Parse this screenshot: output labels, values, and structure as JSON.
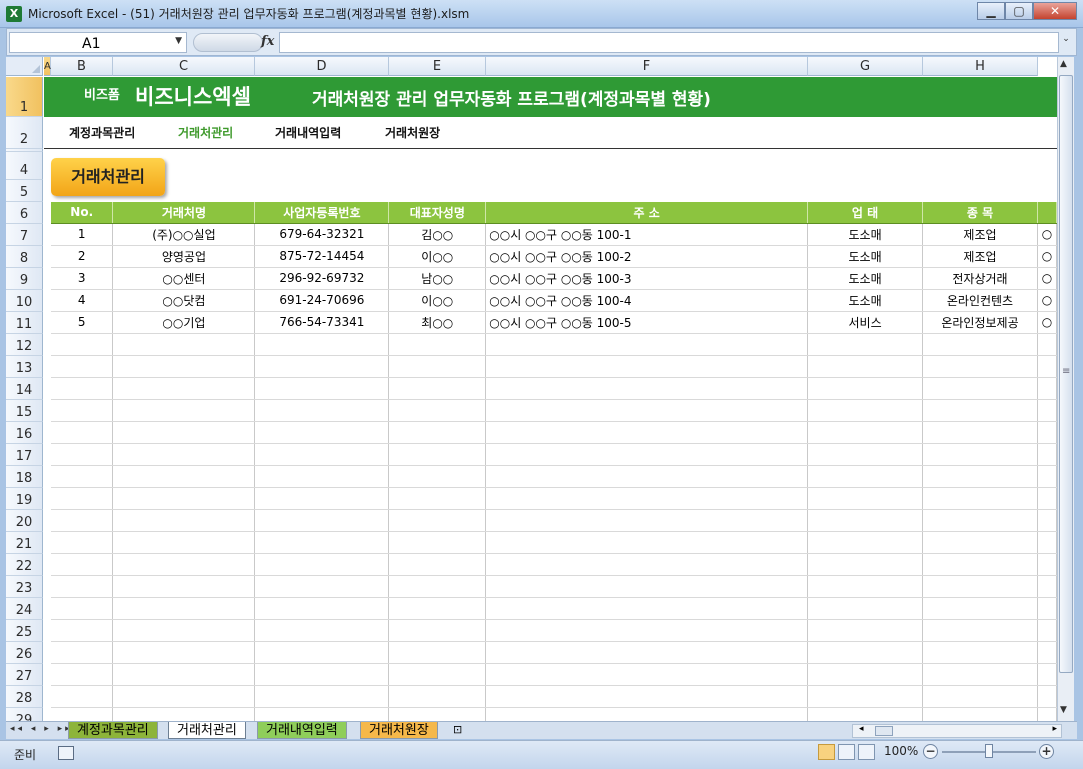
{
  "window": {
    "title": "Microsoft Excel - (51) 거래처원장 관리 업무자동화 프로그램(계정과목별 현황).xlsm",
    "app_icon": "X",
    "min_label": "▁",
    "max_label": "▢",
    "close_label": "✕"
  },
  "formula_bar": {
    "name_box": "A1",
    "fx_label": "fx",
    "formula": ""
  },
  "columns": [
    "A",
    "B",
    "C",
    "D",
    "E",
    "F",
    "G",
    "H"
  ],
  "rows": [
    "1",
    "2",
    "3",
    "4",
    "5",
    "6",
    "7",
    "8",
    "9",
    "10",
    "11",
    "12",
    "13",
    "14",
    "15",
    "16",
    "17",
    "18",
    "19",
    "20",
    "21",
    "22",
    "23",
    "24",
    "25",
    "26",
    "27",
    "28",
    "29"
  ],
  "banner": {
    "brand_small": "비즈폼",
    "brand_big": "비즈니스엑셀",
    "title": "거래처원장 관리 업무자동화 프로그램(계정과목별 현황)"
  },
  "nav": [
    {
      "label": "계정과목관리",
      "active": false
    },
    {
      "label": "거래처관리",
      "active": true
    },
    {
      "label": "거래내역입력",
      "active": false
    },
    {
      "label": "거래처원장",
      "active": false
    }
  ],
  "section_button": "거래처관리",
  "table": {
    "headers": [
      "No.",
      "거래처명",
      "사업자등록번호",
      "대표자성명",
      "주 소",
      "업 태",
      "종 목",
      ""
    ],
    "rows": [
      [
        "1",
        "(주)○○실업",
        "679-64-32321",
        "김○○",
        "○○시 ○○구 ○○동 100-1",
        "도소매",
        "제조업",
        "○"
      ],
      [
        "2",
        "양영공업",
        "875-72-14454",
        "이○○",
        "○○시 ○○구 ○○동 100-2",
        "도소매",
        "제조업",
        "○"
      ],
      [
        "3",
        "○○센터",
        "296-92-69732",
        "남○○",
        "○○시 ○○구 ○○동 100-3",
        "도소매",
        "전자상거래",
        "○"
      ],
      [
        "4",
        "○○닷컴",
        "691-24-70696",
        "이○○",
        "○○시 ○○구 ○○동 100-4",
        "도소매",
        "온라인컨텐츠",
        "○"
      ],
      [
        "5",
        "○○기업",
        "766-54-73341",
        "최○○",
        "○○시 ○○구 ○○동 100-5",
        "서비스",
        "온라인정보제공",
        "○"
      ]
    ]
  },
  "sheet_tabs": [
    {
      "label": "계정과목관리",
      "color": "#8db43a",
      "active": false
    },
    {
      "label": "거래처관리",
      "color": "#ffffff",
      "active": true
    },
    {
      "label": "거래내역입력",
      "color": "#8fce5a",
      "active": false
    },
    {
      "label": "거래처원장",
      "color": "#f5b84a",
      "active": false
    }
  ],
  "status": {
    "ready": "준비",
    "zoom": "100%"
  },
  "colors": {
    "banner": "#2f9a35",
    "table_header": "#8cc43f",
    "section_button": "#f2a417",
    "active_nav": "#3f9a2c"
  }
}
